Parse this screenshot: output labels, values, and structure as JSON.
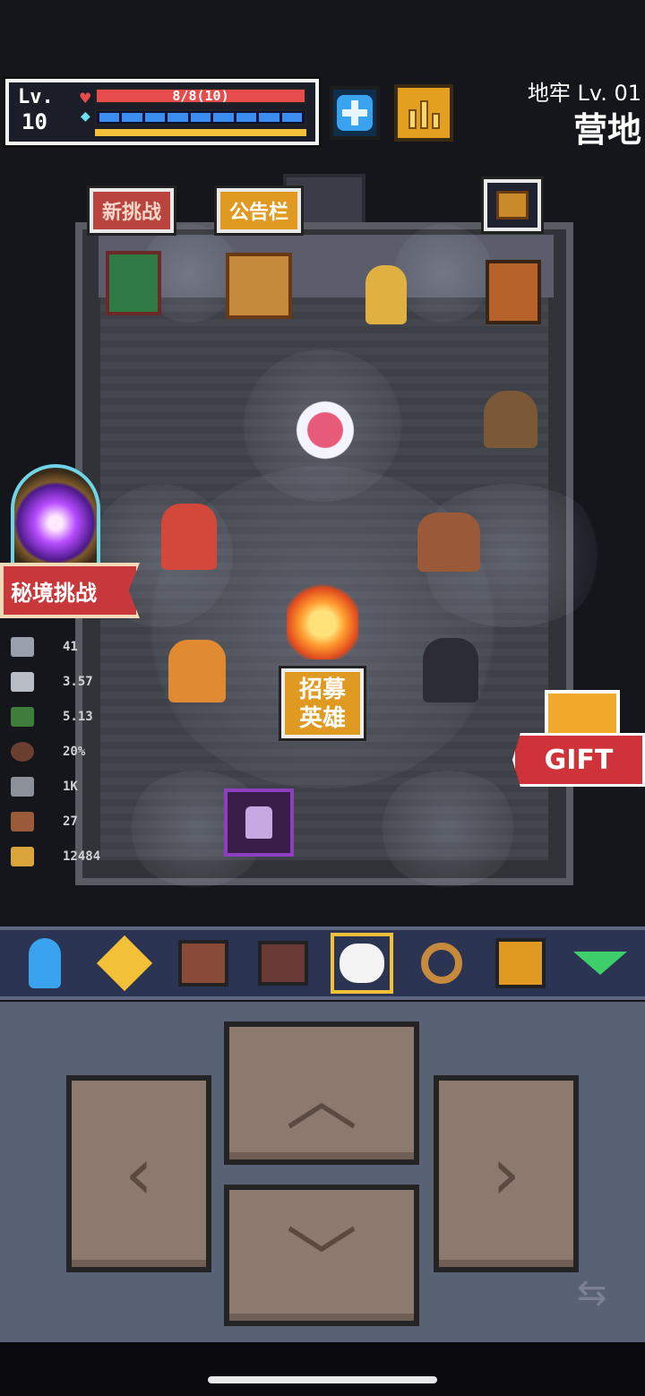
{
  "hud": {
    "level_label": "Lv.",
    "level_value": "10",
    "hp_text": "8/8(10)",
    "mp_segments": 9,
    "colors": {
      "hp": "#e74c4c",
      "mp": "#3c8df0",
      "xp": "#f3c137"
    }
  },
  "location": {
    "dungeon_level": "地牢 Lv. 01",
    "zone_name": "营地"
  },
  "signs": {
    "challenge": "新挑战",
    "bulletin": "公告栏",
    "recruit_line1": "招募",
    "recruit_line2": "英雄"
  },
  "secret_challenge": "秘境挑战",
  "stats": [
    {
      "icon": "sword-icon",
      "value": "41"
    },
    {
      "icon": "blade-icon",
      "value": "3.57"
    },
    {
      "icon": "boot-icon",
      "value": "5.13"
    },
    {
      "icon": "shield-icon",
      "value": "20%"
    },
    {
      "icon": "key-icon",
      "value": "1K"
    },
    {
      "icon": "key-bronze-icon",
      "value": "27"
    },
    {
      "icon": "gold-icon",
      "value": "12484"
    }
  ],
  "gift_label": "GIFT",
  "toolbar": [
    {
      "name": "hero-icon"
    },
    {
      "name": "skill-star-icon"
    },
    {
      "name": "book-icon"
    },
    {
      "name": "bag-icon"
    },
    {
      "name": "focus-icon"
    },
    {
      "name": "search-icon"
    },
    {
      "name": "pause-icon"
    },
    {
      "name": "collapse-icon"
    }
  ]
}
